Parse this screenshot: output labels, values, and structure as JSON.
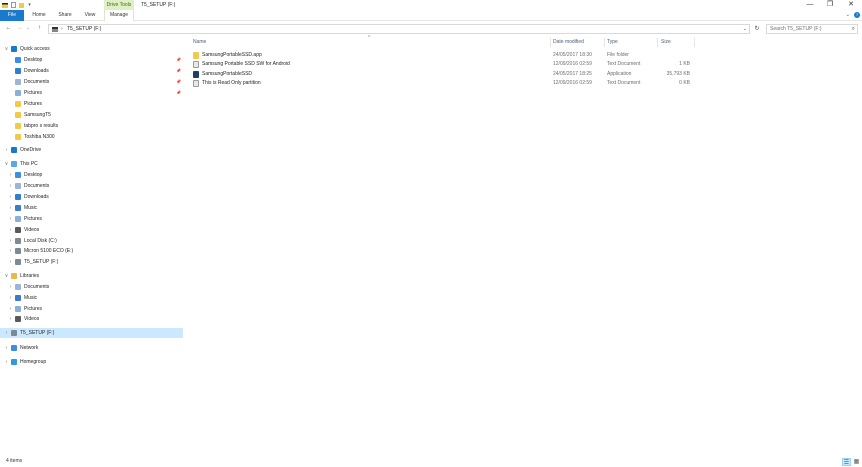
{
  "window": {
    "title": "T5_SETUP (F:)",
    "contextual_tab_group": "Drive Tools",
    "controls": {
      "minimize": "—",
      "maximize": "❐",
      "close": "✕"
    }
  },
  "ribbon": {
    "tabs": [
      {
        "label": "File"
      },
      {
        "label": "Home"
      },
      {
        "label": "Share"
      },
      {
        "label": "View"
      },
      {
        "label": "Manage"
      }
    ],
    "expand_glyph": "⌄",
    "help_glyph": "?"
  },
  "navigation": {
    "back": "←",
    "forward": "→",
    "recent": "⌄",
    "up": "↑",
    "address_separator": "›",
    "address_path": "T5_SETUP (F:)",
    "address_dropdown": "⌄",
    "refresh": "↻",
    "search_placeholder": "Search T5_SETUP (F:)",
    "search_glyph": "⌕"
  },
  "nav_pane": [
    {
      "label": "Quick access",
      "icon": "star-icon",
      "color": "#1979ca",
      "level": 0,
      "chevron": "∨",
      "pinned": false
    },
    {
      "label": "Desktop",
      "icon": "desktop-icon",
      "color": "#3a8ee6",
      "level": 1,
      "chevron": "",
      "pinned": true
    },
    {
      "label": "Downloads",
      "icon": "download-icon",
      "color": "#2f80d1",
      "level": 1,
      "chevron": "",
      "pinned": true
    },
    {
      "label": "Documents",
      "icon": "documents-icon",
      "color": "#9bb6d6",
      "level": 1,
      "chevron": "",
      "pinned": true
    },
    {
      "label": "Pictures",
      "icon": "pictures-icon",
      "color": "#8ab0d8",
      "level": 1,
      "chevron": "",
      "pinned": true
    },
    {
      "label": "Pictures",
      "icon": "folder-icon",
      "color": "#f3c948",
      "level": 1,
      "chevron": "",
      "pinned": false
    },
    {
      "label": "SamsungT5",
      "icon": "folder-icon",
      "color": "#f3c948",
      "level": 1,
      "chevron": "",
      "pinned": false
    },
    {
      "label": "tabpro s results",
      "icon": "folder-icon",
      "color": "#f3c948",
      "level": 1,
      "chevron": "",
      "pinned": false
    },
    {
      "label": "Toshiba N300",
      "icon": "folder-icon",
      "color": "#f3c948",
      "level": 1,
      "chevron": "",
      "pinned": false
    },
    {
      "label": "OneDrive",
      "icon": "cloud-icon",
      "color": "#1979ca",
      "level": 0,
      "chevron": "›",
      "pinned": false
    },
    {
      "label": "This PC",
      "icon": "computer-icon",
      "color": "#5aa6e8",
      "level": 0,
      "chevron": "∨",
      "pinned": false
    },
    {
      "label": "Desktop",
      "icon": "desktop-icon",
      "color": "#3a8ee6",
      "level": 1,
      "chevron": "›",
      "pinned": false
    },
    {
      "label": "Documents",
      "icon": "documents-icon",
      "color": "#9bb6d6",
      "level": 1,
      "chevron": "›",
      "pinned": false
    },
    {
      "label": "Downloads",
      "icon": "download-icon",
      "color": "#2f80d1",
      "level": 1,
      "chevron": "›",
      "pinned": false
    },
    {
      "label": "Music",
      "icon": "music-icon",
      "color": "#3d7cc9",
      "level": 1,
      "chevron": "›",
      "pinned": false
    },
    {
      "label": "Pictures",
      "icon": "pictures-icon",
      "color": "#8ab0d8",
      "level": 1,
      "chevron": "›",
      "pinned": false
    },
    {
      "label": "Videos",
      "icon": "video-icon",
      "color": "#5a5a5a",
      "level": 1,
      "chevron": "›",
      "pinned": false
    },
    {
      "label": "Local Disk (C:)",
      "icon": "drive-icon",
      "color": "#7d8a96",
      "level": 1,
      "chevron": "›",
      "pinned": false
    },
    {
      "label": "Micron 5100 ECO (E:)",
      "icon": "drive-icon",
      "color": "#7d8a96",
      "level": 1,
      "chevron": "›",
      "pinned": false
    },
    {
      "label": "T5_SETUP (F:)",
      "icon": "drive-icon",
      "color": "#7d8a96",
      "level": 1,
      "chevron": "›",
      "pinned": false
    },
    {
      "label": "Libraries",
      "icon": "library-icon",
      "color": "#e8b84a",
      "level": 0,
      "chevron": "∨",
      "pinned": false
    },
    {
      "label": "Documents",
      "icon": "documents-icon",
      "color": "#9bb6d6",
      "level": 1,
      "chevron": "›",
      "pinned": false
    },
    {
      "label": "Music",
      "icon": "music-icon",
      "color": "#3d7cc9",
      "level": 1,
      "chevron": "›",
      "pinned": false
    },
    {
      "label": "Pictures",
      "icon": "pictures-icon",
      "color": "#8ab0d8",
      "level": 1,
      "chevron": "›",
      "pinned": false
    },
    {
      "label": "Videos",
      "icon": "video-icon",
      "color": "#5a5a5a",
      "level": 1,
      "chevron": "›",
      "pinned": false
    },
    {
      "label": "T5_SETUP (F:)",
      "icon": "drive-icon",
      "color": "#7d8a96",
      "level": 0,
      "chevron": "›",
      "pinned": false,
      "selected": true
    },
    {
      "label": "Network",
      "icon": "network-icon",
      "color": "#3a8ee6",
      "level": 0,
      "chevron": "›",
      "pinned": false
    },
    {
      "label": "Homegroup",
      "icon": "homegroup-icon",
      "color": "#2e9bd6",
      "level": 0,
      "chevron": "›",
      "pinned": false
    }
  ],
  "nav_pin_glyph": "📌",
  "file_list": {
    "columns": [
      {
        "key": "name",
        "label": "Name"
      },
      {
        "key": "date",
        "label": "Date modified"
      },
      {
        "key": "type",
        "label": "Type"
      },
      {
        "key": "size",
        "label": "Size"
      }
    ],
    "sort_glyph": "^",
    "rows": [
      {
        "name": "SamsungPortableSSD.app",
        "date": "24/05/2017 18:30",
        "type": "File folder",
        "size": "",
        "icon": "folder-icon",
        "color": "#f3c948"
      },
      {
        "name": "Samsung Portable SSD SW for Android",
        "date": "12/09/2016 02:59",
        "type": "Text Document",
        "size": "1 KB",
        "icon": "text-document-icon",
        "color": "#e9e9e9"
      },
      {
        "name": "SamsungPortableSSD",
        "date": "24/05/2017 18:25",
        "type": "Application",
        "size": "35,793 KB",
        "icon": "application-icon",
        "color": "#1f3f66"
      },
      {
        "name": "This is Read Only partition",
        "date": "12/09/2016 02:59",
        "type": "Text Document",
        "size": "0 KB",
        "icon": "text-document-icon",
        "color": "#e9e9e9"
      }
    ]
  },
  "status_bar": {
    "item_count": "4 items",
    "details_view_glyph": "☰",
    "large_icons_view_glyph": "▦"
  }
}
